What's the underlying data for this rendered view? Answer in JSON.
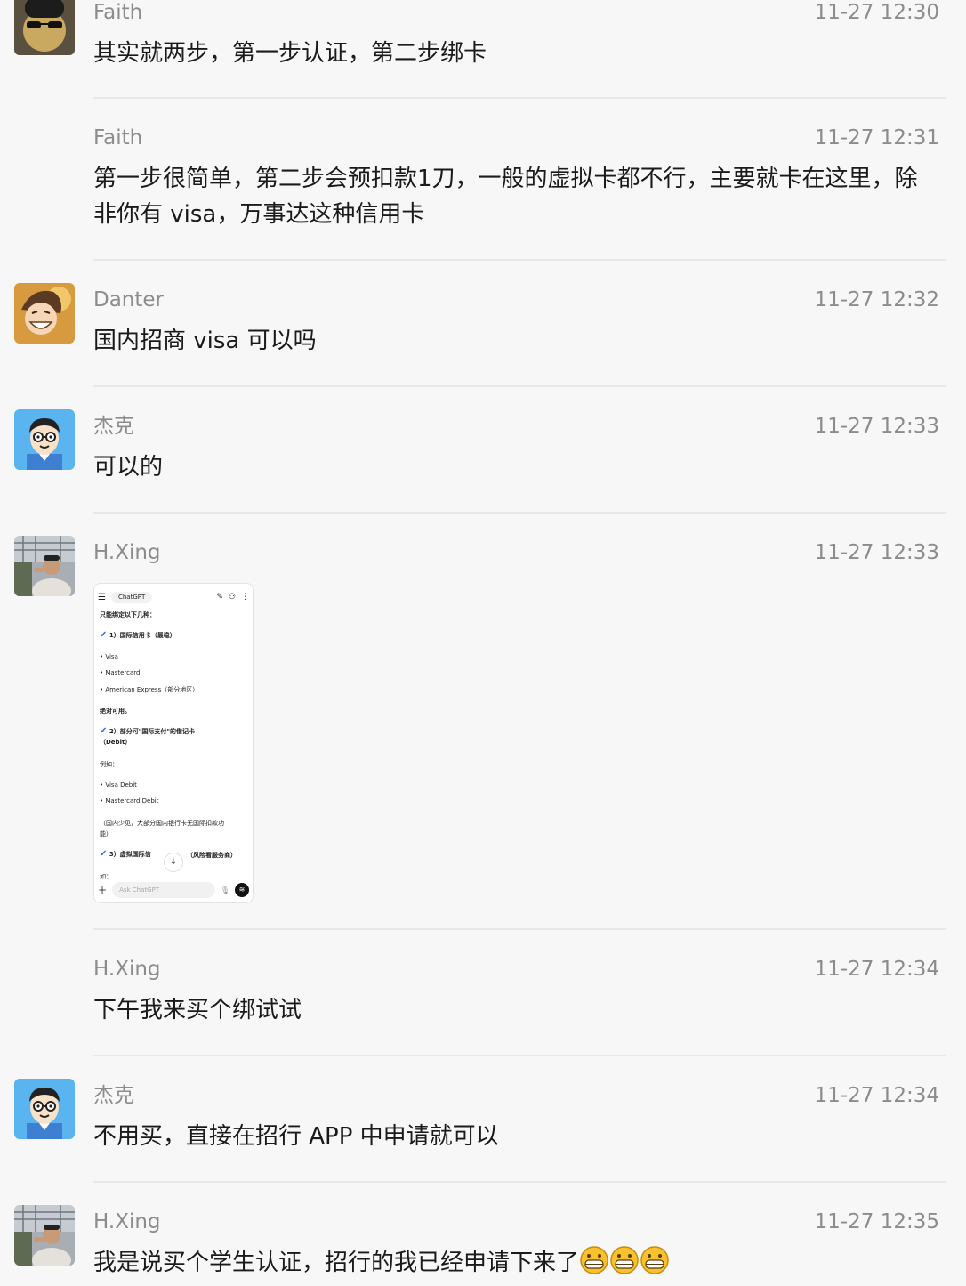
{
  "messages": [
    {
      "name": "Faith",
      "time": "11-27 12:30",
      "text": "其实就两步，第一步认证，第二步绑卡"
    },
    {
      "name": "Faith",
      "time": "11-27 12:31",
      "text": "第一步很简单，第二步会预扣款1刀，一般的虚拟卡都不行，主要就卡在这里，除非你有 visa，万事达这种信用卡"
    },
    {
      "name": "Danter",
      "time": "11-27 12:32",
      "text": "国内招商 visa 可以吗"
    },
    {
      "name": "杰克",
      "time": "11-27 12:33",
      "text": "可以的"
    },
    {
      "name": "H.Xing",
      "time": "11-27 12:33",
      "text": ""
    },
    {
      "name": "H.Xing",
      "time": "11-27 12:34",
      "text": "下午我来买个绑试试"
    },
    {
      "name": "杰克",
      "time": "11-27 12:34",
      "text": "不用买，直接在招行 APP 中申请就可以"
    },
    {
      "name": "H.Xing",
      "time": "11-27 12:35",
      "text": "我是说买个学生认证，招行的我已经申请下来了"
    }
  ],
  "screenshot": {
    "app_title": "ChatGPT",
    "lines": [
      "只能绑定以下几种：",
      "1）国际信用卡（最稳）",
      "• Visa",
      "• Mastercard",
      "• American Express（部分地区）",
      "绝对可用。",
      "2）部分可\"国际支付\"的借记卡",
      "（Debit）",
      "例如：",
      "• Visa Debit",
      "• Mastercard Debit",
      "（国内少见，大部分国内银行卡无国际扣款功",
      "能）",
      "3）虚拟国际信",
      "（风险看服务商）",
      "如："
    ],
    "input_placeholder": "Ask ChatGPT"
  },
  "icons": {
    "menu": "menu-icon",
    "edit": "edit-icon",
    "person": "person-add-icon",
    "more": "more-icon",
    "plus": "plus-icon",
    "mic": "mic-icon",
    "voice": "voice-icon",
    "scroll": "arrow-down-icon",
    "emoji": "grinning-emoji"
  },
  "colors": {
    "background": "#f7f7f7",
    "text": "#1a1a1a",
    "meta": "#8c8c8c",
    "check": "#2f6fd6"
  }
}
